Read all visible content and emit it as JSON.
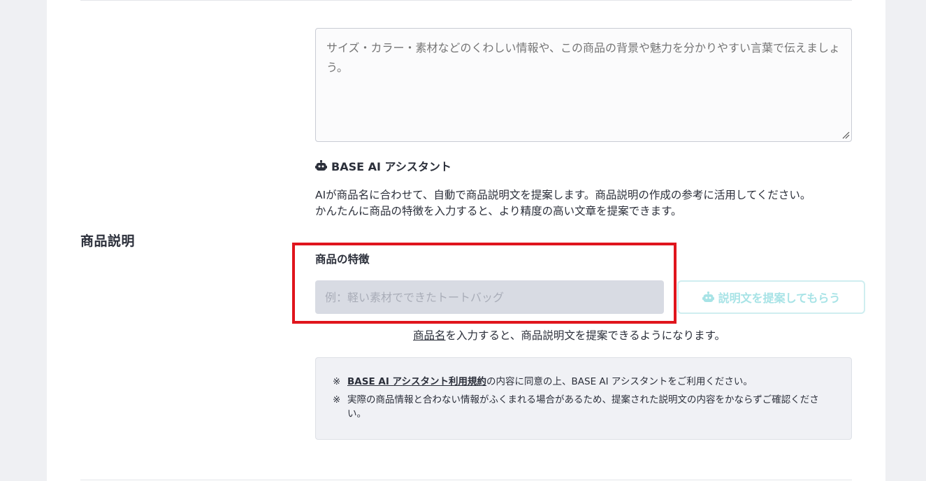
{
  "field": {
    "label": "商品説明",
    "placeholder": "サイズ・カラー・素材などのくわしい情報や、この商品の背景や魅力を分かりやすい言葉で伝えましょう。"
  },
  "ai_assistant": {
    "title": "BASE AI アシスタント",
    "description_1": "AIが商品名に合わせて、自動で商品説明文を提案します。商品説明の作成の参考に活用してください。",
    "description_2": "かんたんに商品の特徴を入力すると、より精度の高い文章を提案できます。",
    "feature_label": "商品の特徴",
    "feature_placeholder": "例：軽い素材でできたトートバッグ",
    "suggest_button": "説明文を提案してもらう",
    "hint_link": "商品名",
    "hint_rest": "を入力すると、商品説明文を提案できるようになります。"
  },
  "notice": {
    "mark": "※",
    "row1_link": "BASE AI アシスタント利用規約",
    "row1_rest": "の内容に同意の上、BASE AI アシスタントをご利用ください。",
    "row2": "実際の商品情報と合わない情報がふくまれる場合があるため、提案された説明文の内容をかならずご確認ください。"
  },
  "colors": {
    "highlight": "#e0151d",
    "button_disabled": "#a7e3e6"
  }
}
